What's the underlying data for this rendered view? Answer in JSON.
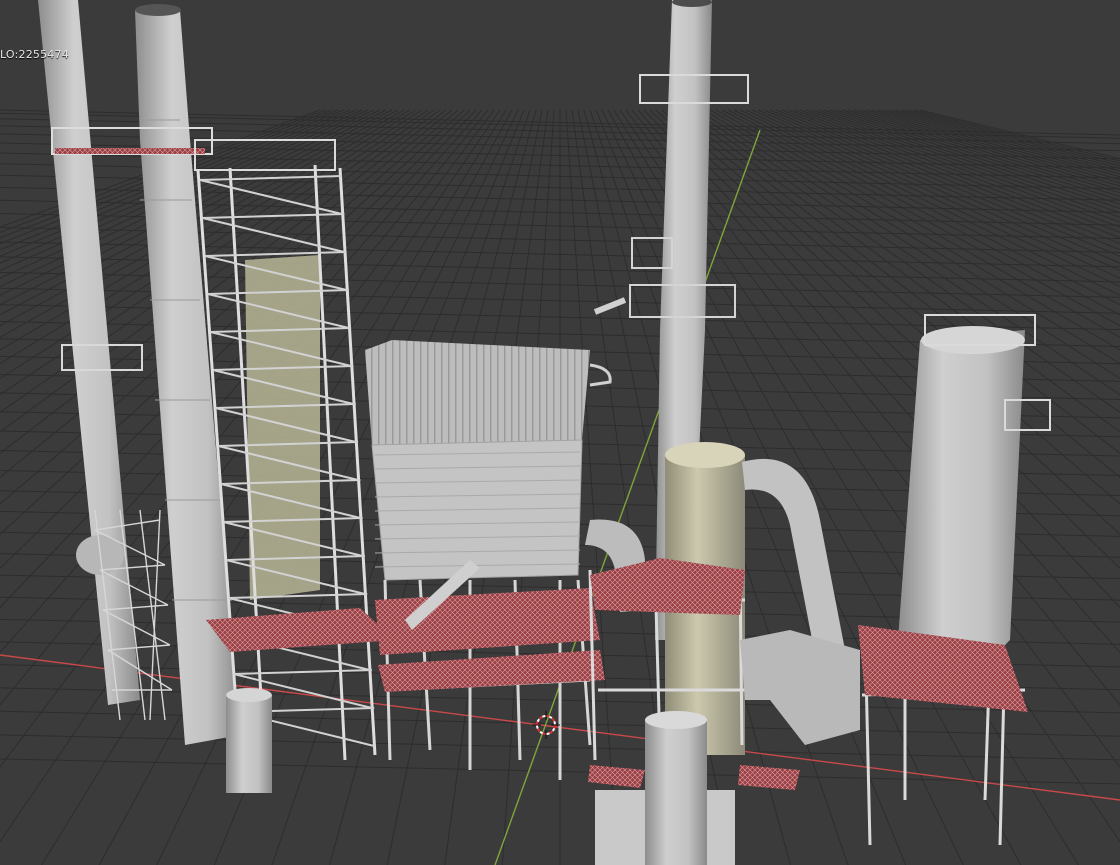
{
  "viewport": {
    "stats_text": "LO:2255474",
    "background": "#3b3b3b",
    "grid_color": "#2d2d2d",
    "x_axis_color": "#c9494a",
    "y_axis_color": "#7ea63a",
    "model_color": "#c8c8c8",
    "walkway_color": "#b8474c",
    "tank_tint": "#b7b39a",
    "cursor_color": "#e03030"
  }
}
